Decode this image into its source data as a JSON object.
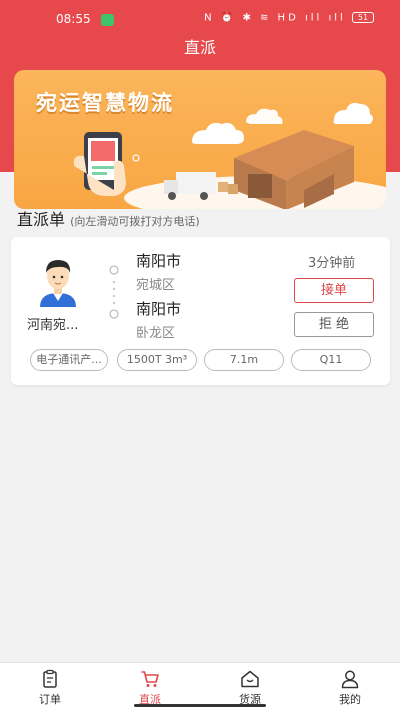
{
  "status_bar": {
    "time": "08:55",
    "icons_text": "N ⏰ ✱ ≋ HD ıll ıll",
    "battery": "51"
  },
  "nav": {
    "title": "直派"
  },
  "banner": {
    "title": "宛运智慧物流"
  },
  "section": {
    "title": "直派单",
    "hint": "(向左滑动可拨打对方电话)"
  },
  "order": {
    "shipper_name": "河南宛...",
    "from_city": "南阳市",
    "from_district": "宛城区",
    "to_city": "南阳市",
    "to_district": "卧龙区",
    "time_ago": "3分钟前",
    "accept_label": "接单",
    "reject_label": "拒 绝",
    "tags": [
      "电子通讯产...",
      "1500T 3m³",
      "7.1m",
      "Q11"
    ]
  },
  "tabbar": {
    "items": [
      {
        "label": "订单",
        "icon": "order-icon"
      },
      {
        "label": "直派",
        "icon": "cart-icon"
      },
      {
        "label": "货源",
        "icon": "house-icon"
      },
      {
        "label": "我的",
        "icon": "user-icon"
      }
    ],
    "active_index": 1
  },
  "colors": {
    "primary": "#e7484b",
    "banner": "#f8a643",
    "background": "#f2f2f2"
  }
}
